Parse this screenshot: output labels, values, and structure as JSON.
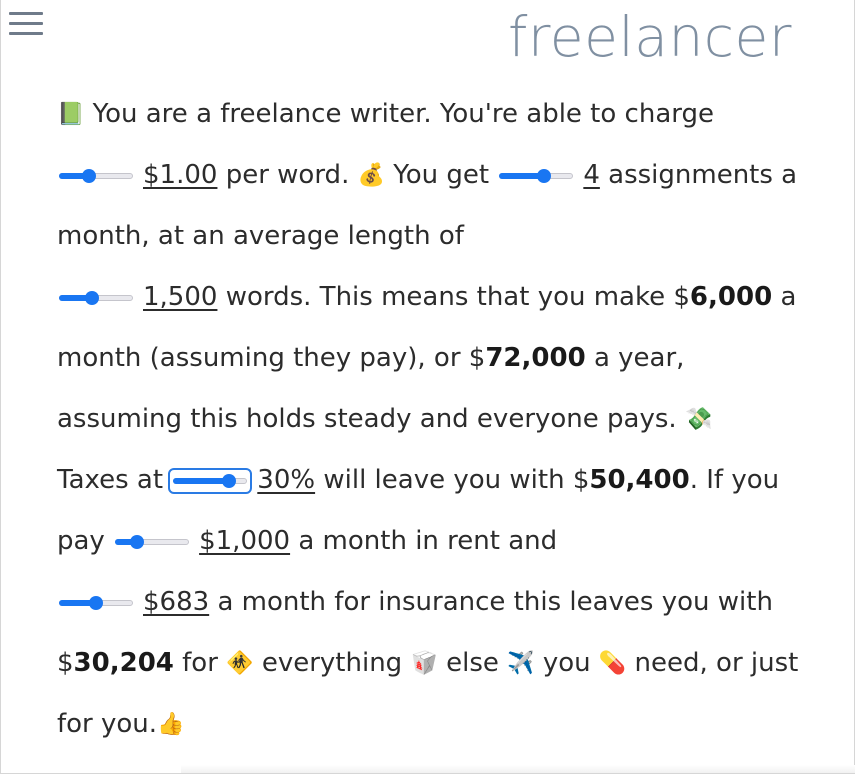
{
  "header": {
    "brand": "freelancer",
    "menu_icon": "hamburger-menu-icon"
  },
  "story": {
    "intro_icon": "📗",
    "intro_text": "You are a freelance writer. You're able to charge",
    "rate": {
      "value": "$1.00",
      "level": 0.4
    },
    "per_word": "per word.",
    "money_bag_icon": "💰",
    "you_get": "You get",
    "assignments": {
      "value": "4",
      "level": 0.6
    },
    "assignments_text": "assignments a month, at an average length of",
    "length": {
      "value": "1,500",
      "level": 0.45
    },
    "words_text": "words. This means that you make $",
    "monthly": "6,000",
    "monthly_after": "a month (assuming they pay), or $",
    "yearly": "72,000",
    "yearly_after": "a year, assuming this holds steady and everyone pays.",
    "money_wings_icon": "💸",
    "taxes_text": "Taxes at",
    "tax_rate": {
      "value": "30%",
      "level": 0.75
    },
    "tax_after": "will leave you with $",
    "after_tax": "50,400",
    "if_pay": ". If you pay",
    "rent": {
      "value": "$1,000",
      "level": 0.3
    },
    "rent_after": "a month in rent and",
    "insurance": {
      "value": "$683",
      "level": 0.5
    },
    "insurance_after": "a month for insurance this leaves you with $",
    "remaining": "30,204",
    "for_text": "for",
    "children_icon": "🚸",
    "everything": "everything",
    "takeout_icon": "🥡",
    "else_text": "else",
    "airplane_icon": "✈️",
    "you_text": "you",
    "pill_icon": "💊",
    "need_text": "need, or just for you.",
    "thumbs_icon": "👍"
  },
  "colors": {
    "accent": "#1976f2",
    "brand": "#8090a2",
    "text": "#2c2c2c"
  }
}
